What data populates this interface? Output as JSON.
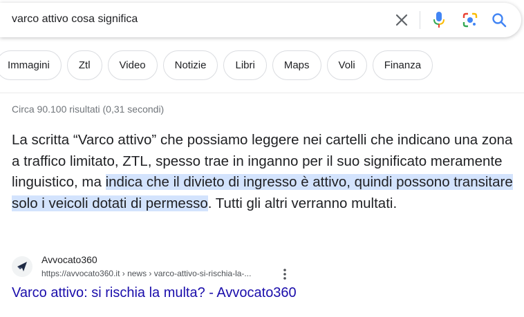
{
  "search": {
    "query": "varco attivo cosa significa"
  },
  "filters": [
    "Immagini",
    "Ztl",
    "Video",
    "Notizie",
    "Libri",
    "Maps",
    "Voli",
    "Finanza"
  ],
  "result_stats": "Circa 90.100 risultati (0,31 secondi)",
  "snippet": {
    "before": "La scritta “Varco attivo” che possiamo leggere nei cartelli che indicano una zona a traffico limitato, ZTL, spesso trae in inganno per il suo significato meramente linguistico, ma ",
    "highlighted": "indica che il divieto di ingresso è attivo, quindi possono transitare solo i veicoli dotati di permesso",
    "after": ". Tutti gli altri verranno multati."
  },
  "source": {
    "name": "Avvocato360",
    "url": "https://avvocato360.it › news › varco-attivo-si-rischia-la-...",
    "title": "Varco attivo: si rischia la multa? - Avvocato360"
  },
  "colors": {
    "link": "#1a0dab",
    "highlight": "#d3e3fd",
    "google_blue": "#4285f4",
    "google_red": "#ea4335",
    "google_yellow": "#fbbc04",
    "google_green": "#34a853"
  },
  "icons": [
    "clear-icon",
    "mic-icon",
    "lens-icon",
    "search-icon",
    "avvocato360-favicon-icon",
    "more-vert-icon"
  ]
}
